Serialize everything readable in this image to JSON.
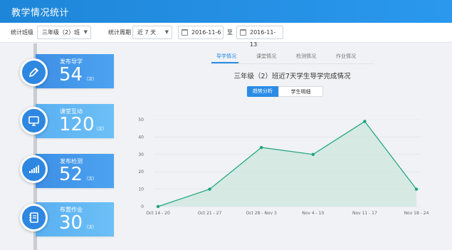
{
  "app": {
    "title": "教学情况统计"
  },
  "filters": {
    "class_label": "统计班级",
    "class_value": "三年级（2）班",
    "period_label": "统计周期",
    "period_value": "近 7 天",
    "start_date": "2016-11-6",
    "range_separator": "至",
    "end_date": "2016-11-13"
  },
  "cards": [
    {
      "title": "发布导学",
      "value": "54",
      "unit": "（次）",
      "icon": "pencil-icon"
    },
    {
      "title": "课堂互动",
      "value": "120",
      "unit": "（次）",
      "icon": "monitor-icon"
    },
    {
      "title": "发布检测",
      "value": "52",
      "unit": "（次）",
      "icon": "bar-chart-icon"
    },
    {
      "title": "布置作业",
      "value": "30",
      "unit": "（次）",
      "icon": "notebook-icon"
    }
  ],
  "tabs": [
    "导学情况",
    "课堂情况",
    "检测情况",
    "作业情况"
  ],
  "active_tab": 0,
  "chart_title": "三年级（2）班近7天学生导学完成情况",
  "view_toggle": {
    "trend": "趋势分析",
    "detail": "学生明细"
  },
  "colors": {
    "accent": "#2a8be6",
    "line": "#1aa57a",
    "area": "#cfe6df"
  },
  "chart_data": {
    "type": "area",
    "categories": [
      "Oct 14 - 20",
      "Oct 21 - 27",
      "Oct 28 - Nov 3",
      "Nov 4 - 10",
      "Nov 11 - 17",
      "Nov 18 - 24"
    ],
    "series": [
      {
        "values": [
          0,
          10,
          34,
          30,
          49,
          10
        ]
      }
    ],
    "yticks": [
      0,
      10,
      20,
      30,
      40,
      50
    ],
    "ylim": [
      0,
      50
    ],
    "grid": true
  }
}
